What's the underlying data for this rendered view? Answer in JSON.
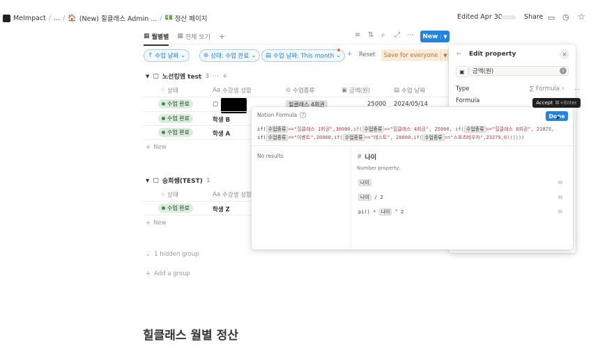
{
  "breadcrumb": {
    "workspace": "MeImpact",
    "ellipsis": "...",
    "parent": "(New) 힐클래스 Admin ...",
    "current": "정산 페이지"
  },
  "topbar": {
    "edited": "Edited Apr 30",
    "share": "Share"
  },
  "views": {
    "tabs": [
      {
        "label": "월별별"
      },
      {
        "label": "전체 보기"
      }
    ],
    "add": "+",
    "new_label": "New"
  },
  "filters": {
    "date": "수업 날짜",
    "status": "상태: 수업 완료",
    "date_range": "수업 날짜: This month",
    "reset": "Reset",
    "save": "Save for everyone"
  },
  "groups": [
    {
      "title": "노선킹엠 test",
      "count": "3",
      "columns": [
        "상태",
        "수강생 성함",
        "수업종류",
        "금액(원)",
        "수업 날짜"
      ],
      "rows": [
        {
          "status": "수업 완료",
          "name": "",
          "type": "힐클래스 4회권",
          "amount": "25000",
          "date": "2024/05/14"
        },
        {
          "status": "수업 완료",
          "name": "학생 B"
        },
        {
          "status": "수업 완료",
          "name": "학생 A"
        }
      ],
      "new": "New"
    },
    {
      "title": "승희쌤(TEST)",
      "count": "1",
      "columns": [
        "상태",
        "수강생 성함"
      ],
      "rows": [
        {
          "status": "수업 완료",
          "name": "학생 Z"
        }
      ],
      "new": "New"
    }
  ],
  "hidden_group": "1 hidden group",
  "add_group": "Add a group",
  "page_heading": "힐클래스 월별 정산",
  "formula_editor": {
    "title": "Notion Formula",
    "line1_prefix": "if(",
    "prop": "수업종류",
    "line1": [
      {
        "t": "==\"힐클래스 1회권\",30000,if("
      },
      {
        "t": "==\"힐클래스 4회권\", 25000, if("
      },
      {
        "t": "==\"힐클래스 8회권\", 21875,"
      }
    ],
    "line2_prefix": "if(",
    "line2": [
      {
        "t": "==\"이벤트\",20000,if("
      },
      {
        "t": "==\"테스트\", 20000,if("
      },
      {
        "t": "==\"스포츠바우처\",23279,0))))))"
      }
    ],
    "no_results": "No results",
    "detail_name": "나이",
    "detail_hash": "#",
    "detail_desc": "Number property.",
    "examples": [
      {
        "pre": "",
        "prop": "나이",
        "post": ""
      },
      {
        "pre": "",
        "prop": "나이",
        "post": " / 2"
      },
      {
        "pre": "pi() * ",
        "prop": "나이",
        "post": " ^ 2"
      }
    ],
    "done": "Done",
    "tooltip_label": "Accept",
    "tooltip_key": "⌘+Enter"
  },
  "edit_property": {
    "title": "Edit property",
    "name_value": "금액(원)",
    "type_label": "Type",
    "type_value": "Formula",
    "formula_label": "Formula"
  }
}
